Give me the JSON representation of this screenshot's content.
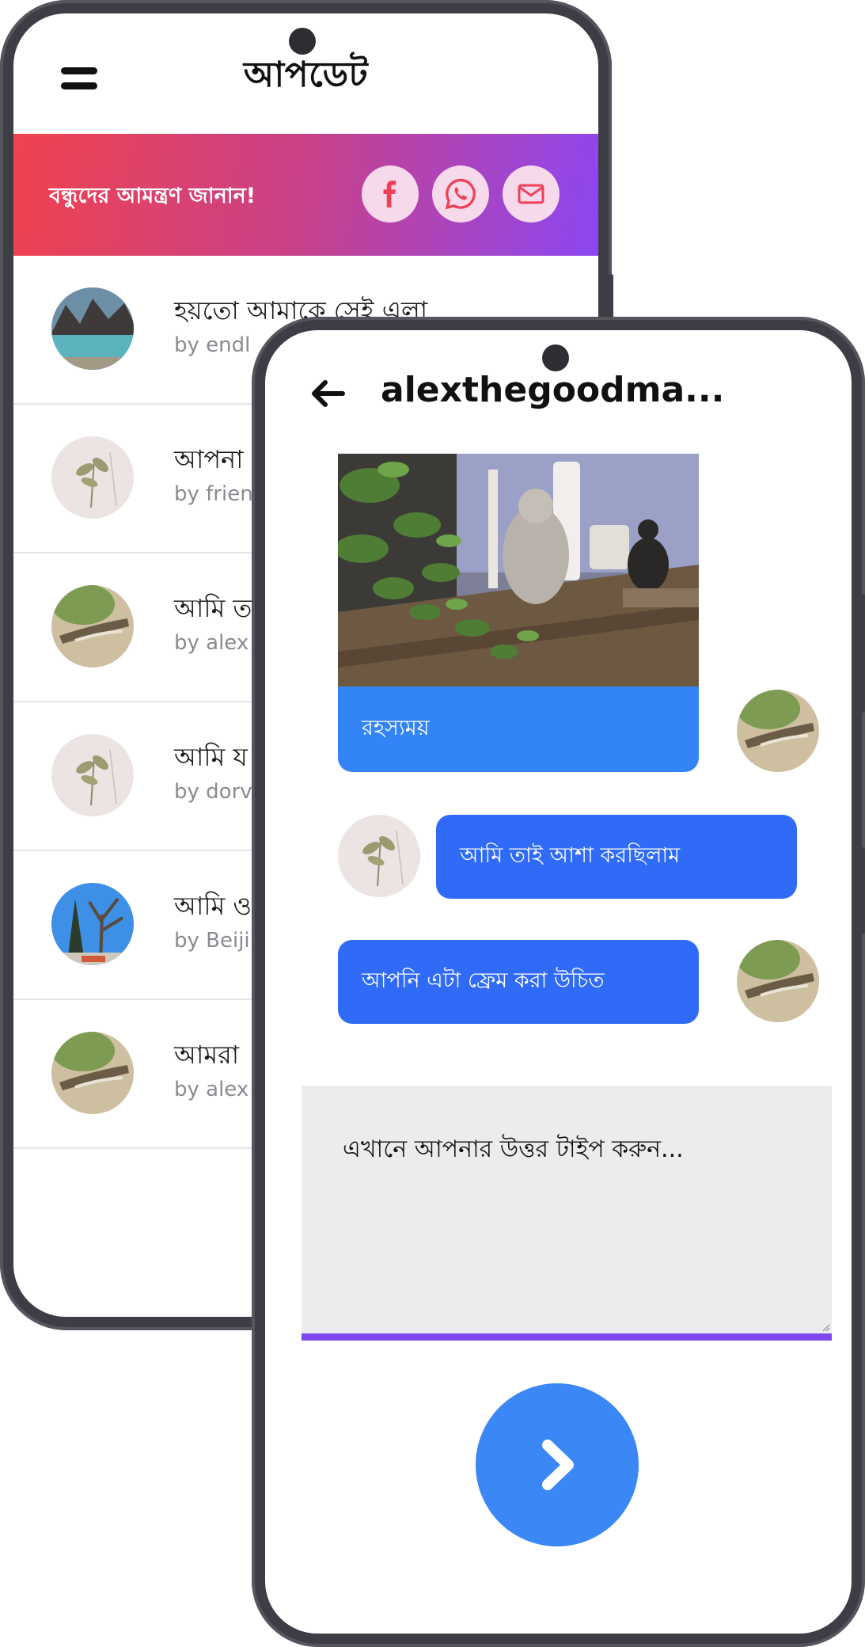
{
  "updates_screen": {
    "title": "আপডেট",
    "invite_text": "বন্ধুদের আমন্ত্রণ জানান!",
    "share_icons": [
      "facebook-icon",
      "whatsapp-icon",
      "mail-icon"
    ],
    "items": [
      {
        "title": "হয়তো আমাকে সেই এলা",
        "author": "by endl"
      },
      {
        "title": "আপনা",
        "author": "by frien"
      },
      {
        "title": "আমি ত",
        "author": "by alex"
      },
      {
        "title": "আমি য",
        "author": "by dorv"
      },
      {
        "title": "আমি ও",
        "author": "by Beiji"
      },
      {
        "title": "আমরা",
        "author": "by alex"
      }
    ]
  },
  "chat_screen": {
    "title": "alexthegoodma...",
    "messages": [
      {
        "type": "image",
        "caption": "রহস্যময়",
        "side": "sent"
      },
      {
        "type": "text",
        "text": "আমি তাই আশা করছিলাম",
        "side": "received"
      },
      {
        "type": "text",
        "text": "আপনি এটা ফ্রেম করা উচিত",
        "side": "sent"
      }
    ],
    "reply_placeholder": "এখানে আপনার উত্তর টাইপ করুন..."
  },
  "colors": {
    "banner_start": "#f0424e",
    "banner_end": "#8c47f2",
    "bubble_blue": "#2f6bf6",
    "send_button": "#3a87f5"
  }
}
